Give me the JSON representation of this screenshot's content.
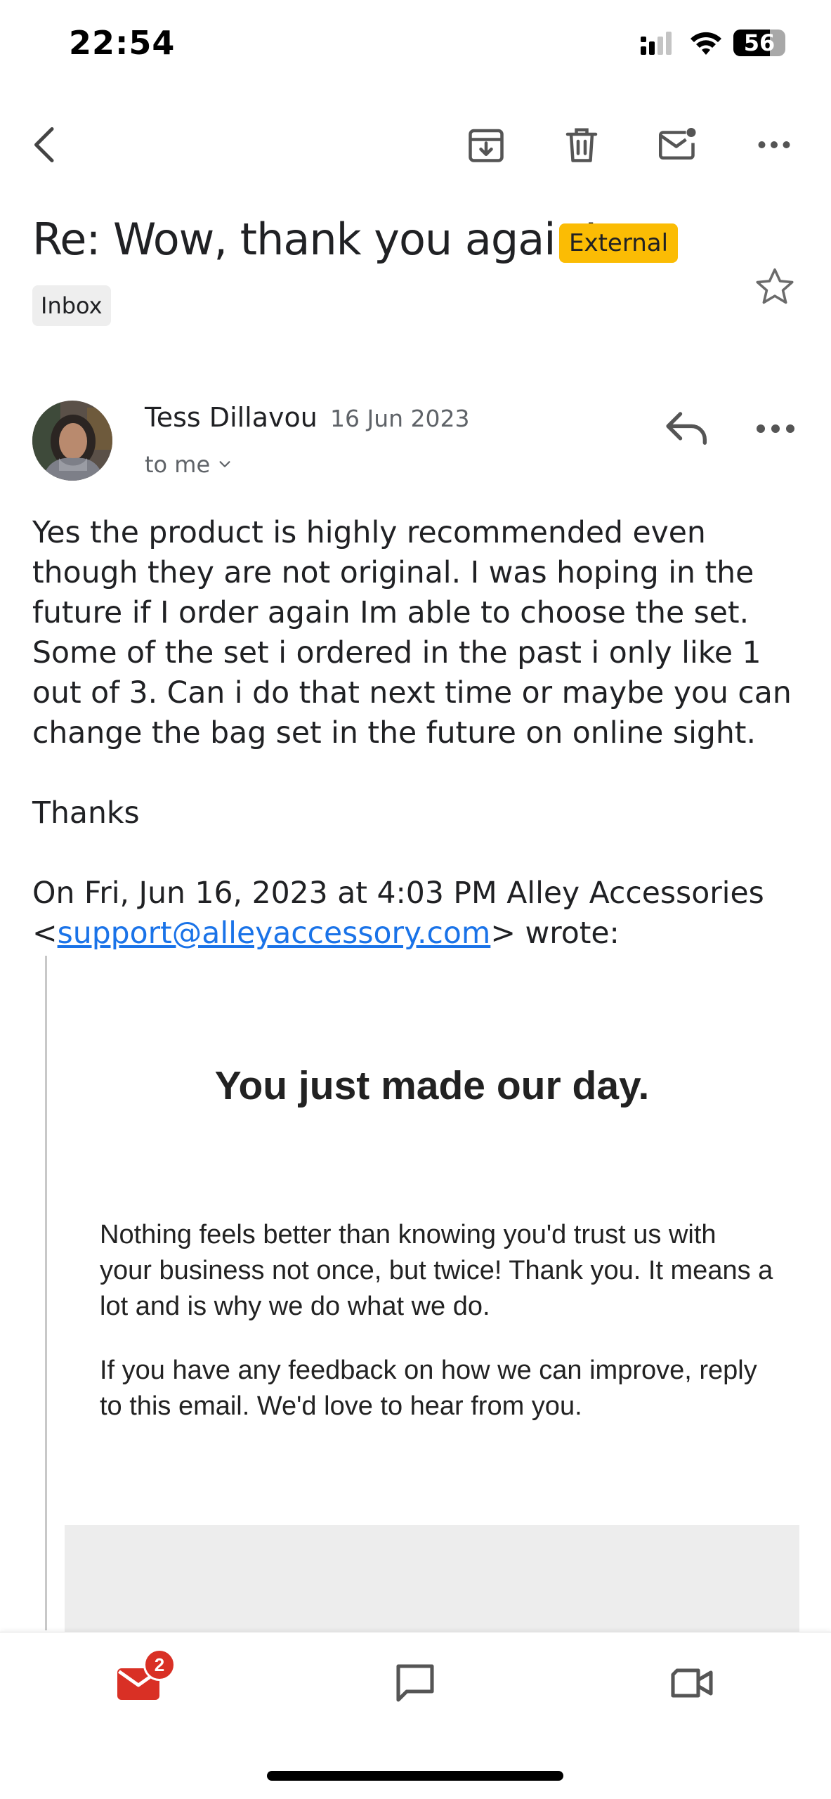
{
  "status_bar": {
    "time": "22:54",
    "battery": "56"
  },
  "email": {
    "subject": "Re: Wow, thank you again!",
    "external_label": "External",
    "folder_label": "Inbox",
    "sender_name": "Tess Dillavou",
    "date": "16 Jun 2023",
    "recipient": "to me",
    "body": [
      "Yes the product is highly recommended even though they are not original. I was hoping in the future if I order again Im able to choose the set. Some of the set i ordered in the past i only like 1 out of 3. Can i do that next time or maybe you can change the bag set in the future on online sight.",
      "Thanks"
    ],
    "quote_intro": "On Fri, Jun 16, 2023 at 4:03 PM Alley Accessories",
    "quote_email": "support@alleyaccessory.com",
    "quote_wrote": "wrote:",
    "quoted_headline": "You just made our day.",
    "quoted_paragraphs": [
      "Nothing feels better than knowing you'd trust us with your business not once, but twice! Thank you. It means a lot and is why we do what we do.",
      "If you have any feedback on how we can improve, reply to this email. We'd love to hear from you."
    ]
  },
  "bottom_nav": {
    "mail_badge": "2"
  },
  "colors": {
    "accent_red": "#d93025",
    "external_yellow": "#fbbc04",
    "link_blue": "#1a73e8"
  },
  "icons": [
    "back-icon",
    "archive-icon",
    "delete-icon",
    "mark-unread-icon",
    "more-icon",
    "star-icon",
    "reply-icon",
    "mail-icon",
    "chat-icon",
    "video-icon"
  ]
}
